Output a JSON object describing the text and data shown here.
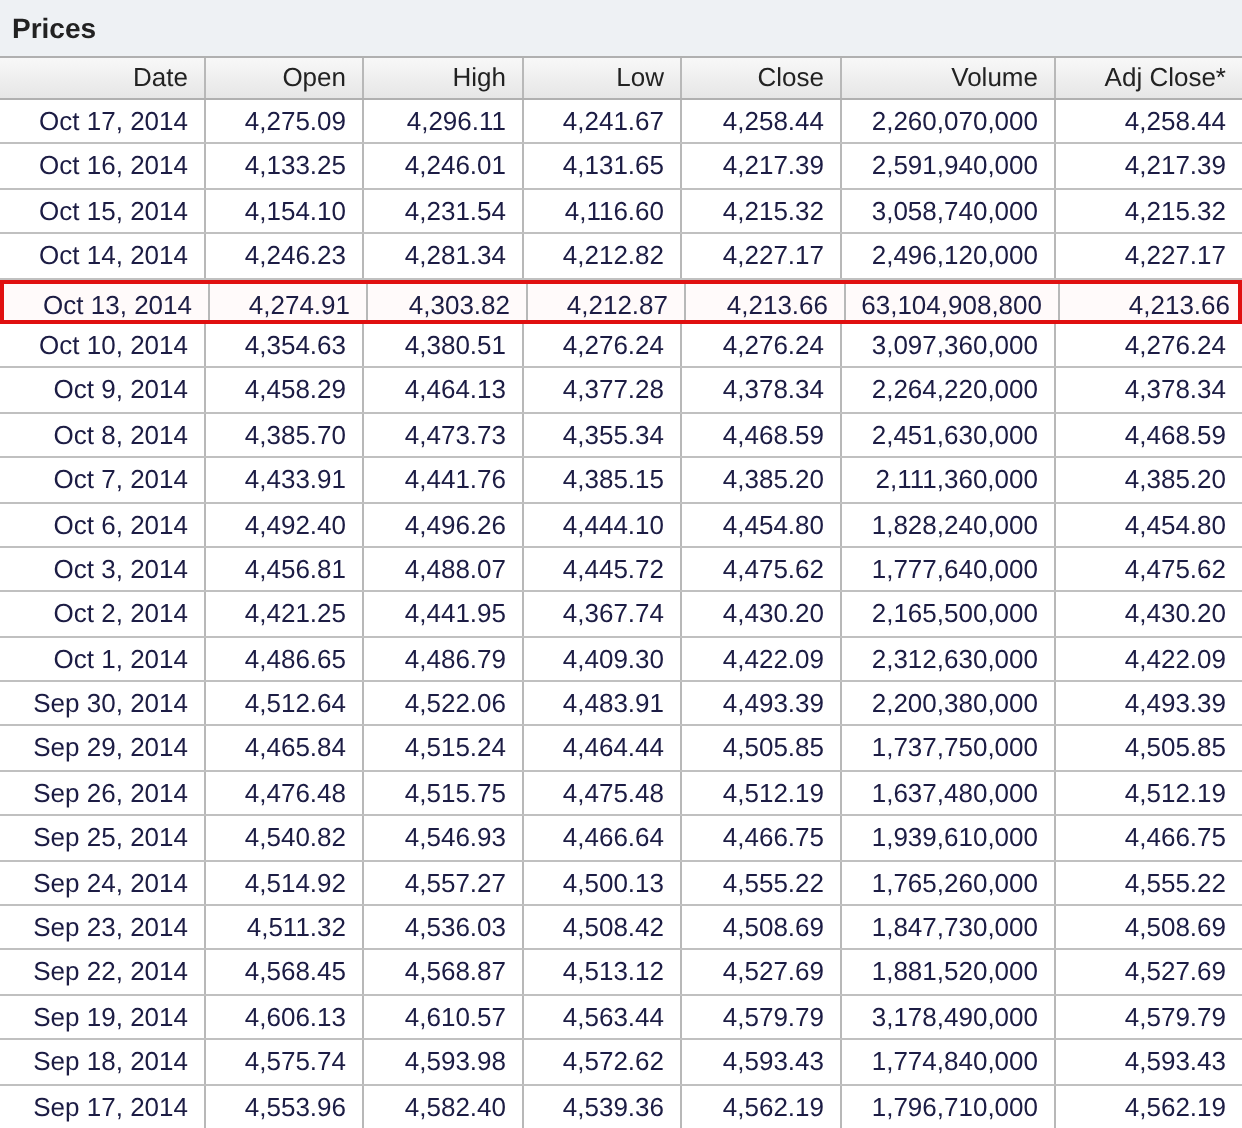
{
  "panel": {
    "title": "Prices"
  },
  "table": {
    "columns": [
      "Date",
      "Open",
      "High",
      "Low",
      "Close",
      "Volume",
      "Adj Close*"
    ],
    "rows": [
      {
        "cells": [
          "Oct 17, 2014",
          "4,275.09",
          "4,296.11",
          "4,241.67",
          "4,258.44",
          "2,260,070,000",
          "4,258.44"
        ],
        "highlighted": false
      },
      {
        "cells": [
          "Oct 16, 2014",
          "4,133.25",
          "4,246.01",
          "4,131.65",
          "4,217.39",
          "2,591,940,000",
          "4,217.39"
        ],
        "highlighted": false
      },
      {
        "cells": [
          "Oct 15, 2014",
          "4,154.10",
          "4,231.54",
          "4,116.60",
          "4,215.32",
          "3,058,740,000",
          "4,215.32"
        ],
        "highlighted": false
      },
      {
        "cells": [
          "Oct 14, 2014",
          "4,246.23",
          "4,281.34",
          "4,212.82",
          "4,227.17",
          "2,496,120,000",
          "4,227.17"
        ],
        "highlighted": false
      },
      {
        "cells": [
          "Oct 13, 2014",
          "4,274.91",
          "4,303.82",
          "4,212.87",
          "4,213.66",
          "63,104,908,800",
          "4,213.66"
        ],
        "highlighted": true
      },
      {
        "cells": [
          "Oct 10, 2014",
          "4,354.63",
          "4,380.51",
          "4,276.24",
          "4,276.24",
          "3,097,360,000",
          "4,276.24"
        ],
        "highlighted": false
      },
      {
        "cells": [
          "Oct 9, 2014",
          "4,458.29",
          "4,464.13",
          "4,377.28",
          "4,378.34",
          "2,264,220,000",
          "4,378.34"
        ],
        "highlighted": false
      },
      {
        "cells": [
          "Oct 8, 2014",
          "4,385.70",
          "4,473.73",
          "4,355.34",
          "4,468.59",
          "2,451,630,000",
          "4,468.59"
        ],
        "highlighted": false
      },
      {
        "cells": [
          "Oct 7, 2014",
          "4,433.91",
          "4,441.76",
          "4,385.15",
          "4,385.20",
          "2,111,360,000",
          "4,385.20"
        ],
        "highlighted": false
      },
      {
        "cells": [
          "Oct 6, 2014",
          "4,492.40",
          "4,496.26",
          "4,444.10",
          "4,454.80",
          "1,828,240,000",
          "4,454.80"
        ],
        "highlighted": false
      },
      {
        "cells": [
          "Oct 3, 2014",
          "4,456.81",
          "4,488.07",
          "4,445.72",
          "4,475.62",
          "1,777,640,000",
          "4,475.62"
        ],
        "highlighted": false
      },
      {
        "cells": [
          "Oct 2, 2014",
          "4,421.25",
          "4,441.95",
          "4,367.74",
          "4,430.20",
          "2,165,500,000",
          "4,430.20"
        ],
        "highlighted": false
      },
      {
        "cells": [
          "Oct 1, 2014",
          "4,486.65",
          "4,486.79",
          "4,409.30",
          "4,422.09",
          "2,312,630,000",
          "4,422.09"
        ],
        "highlighted": false
      },
      {
        "cells": [
          "Sep 30, 2014",
          "4,512.64",
          "4,522.06",
          "4,483.91",
          "4,493.39",
          "2,200,380,000",
          "4,493.39"
        ],
        "highlighted": false
      },
      {
        "cells": [
          "Sep 29, 2014",
          "4,465.84",
          "4,515.24",
          "4,464.44",
          "4,505.85",
          "1,737,750,000",
          "4,505.85"
        ],
        "highlighted": false
      },
      {
        "cells": [
          "Sep 26, 2014",
          "4,476.48",
          "4,515.75",
          "4,475.48",
          "4,512.19",
          "1,637,480,000",
          "4,512.19"
        ],
        "highlighted": false
      },
      {
        "cells": [
          "Sep 25, 2014",
          "4,540.82",
          "4,546.93",
          "4,466.64",
          "4,466.75",
          "1,939,610,000",
          "4,466.75"
        ],
        "highlighted": false
      },
      {
        "cells": [
          "Sep 24, 2014",
          "4,514.92",
          "4,557.27",
          "4,500.13",
          "4,555.22",
          "1,765,260,000",
          "4,555.22"
        ],
        "highlighted": false
      },
      {
        "cells": [
          "Sep 23, 2014",
          "4,511.32",
          "4,536.03",
          "4,508.42",
          "4,508.69",
          "1,847,730,000",
          "4,508.69"
        ],
        "highlighted": false
      },
      {
        "cells": [
          "Sep 22, 2014",
          "4,568.45",
          "4,568.87",
          "4,513.12",
          "4,527.69",
          "1,881,520,000",
          "4,527.69"
        ],
        "highlighted": false
      },
      {
        "cells": [
          "Sep 19, 2014",
          "4,606.13",
          "4,610.57",
          "4,563.44",
          "4,579.79",
          "3,178,490,000",
          "4,579.79"
        ],
        "highlighted": false
      },
      {
        "cells": [
          "Sep 18, 2014",
          "4,575.74",
          "4,593.98",
          "4,572.62",
          "4,593.43",
          "1,774,840,000",
          "4,593.43"
        ],
        "highlighted": false
      },
      {
        "cells": [
          "Sep 17, 2014",
          "4,553.96",
          "4,582.40",
          "4,539.36",
          "4,562.19",
          "1,796,710,000",
          "4,562.19"
        ],
        "highlighted": false
      }
    ]
  }
}
